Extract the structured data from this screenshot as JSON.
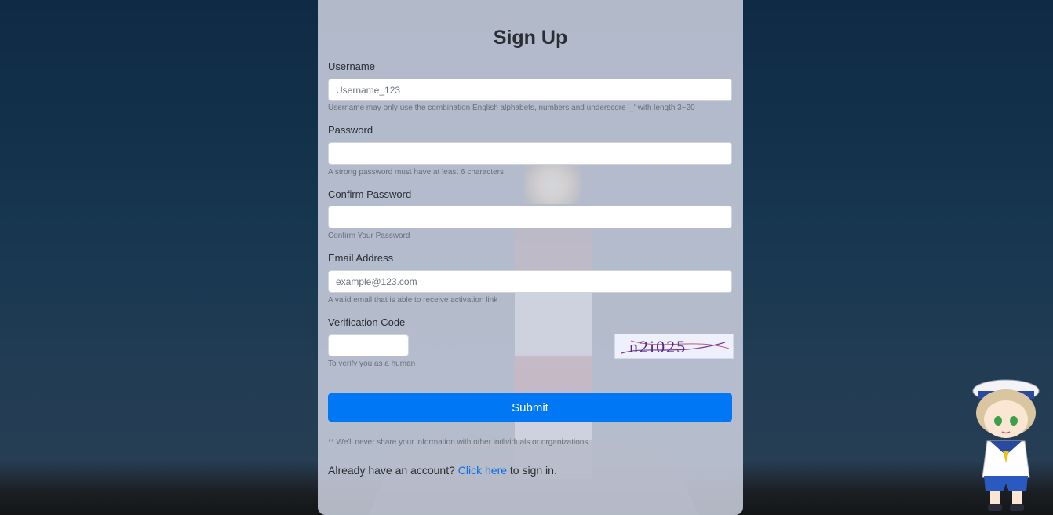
{
  "form": {
    "title": "Sign Up",
    "username": {
      "label": "Username",
      "placeholder": "Username_123",
      "help": "Username may only use the combination English alphabets, numbers and underscore '_' with length 3~20"
    },
    "password": {
      "label": "Password",
      "help": "A strong password must have at least 6 characters"
    },
    "confirm_password": {
      "label": "Confirm Password",
      "help": "Confirm Your Password"
    },
    "email": {
      "label": "Email Address",
      "placeholder": "example@123.com",
      "help": "A valid email that is able to receive activation link"
    },
    "verification": {
      "label": "Verification Code",
      "help": "To verify you as a human",
      "captcha_text": "n2i025"
    },
    "submit_label": "Submit",
    "privacy_note": "** We'll never share your information with other individuals or organizations.",
    "signin": {
      "prefix": "Already have an account?",
      "link": "Click here",
      "suffix": "to sign in."
    }
  },
  "colors": {
    "primary": "#0078f5",
    "link": "#0a6ee6",
    "panel": "rgba(205,210,225,0.86)"
  },
  "icons": {
    "mascot": "sailor-boy-mascot"
  }
}
